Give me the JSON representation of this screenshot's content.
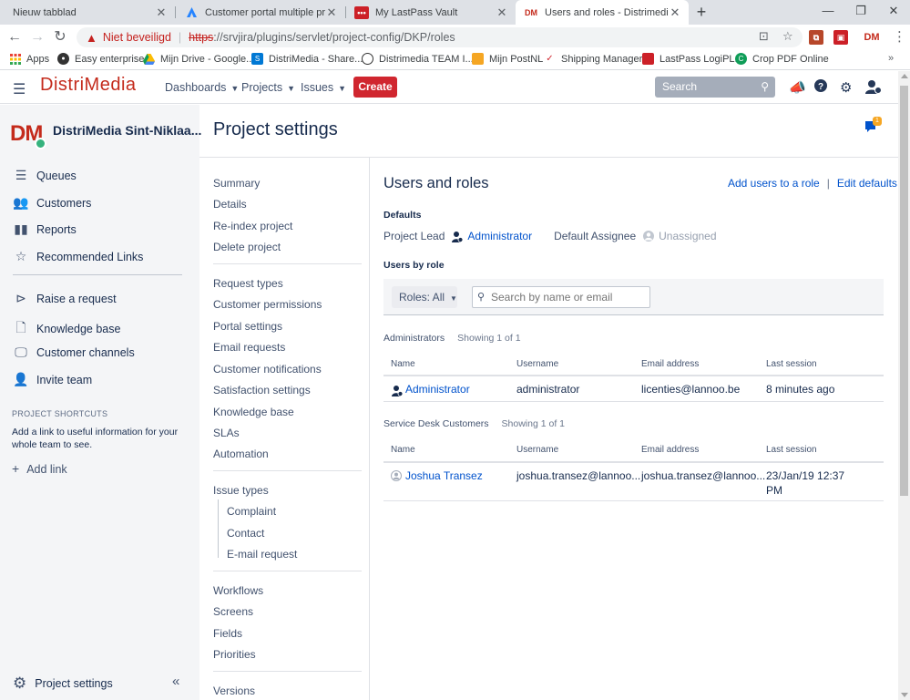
{
  "browser": {
    "tabs": [
      {
        "title": "Nieuw tabblad"
      },
      {
        "title": "Customer portal multiple project"
      },
      {
        "title": "My LastPass Vault"
      },
      {
        "title": "Users and roles - Distrimedia kla",
        "favicon_text": "DM"
      }
    ],
    "new_tab": "+",
    "close_glyph": "✕",
    "window_controls": [
      "—",
      "❐",
      "✕"
    ],
    "address": {
      "security_label": "Niet beveiligd",
      "protocol": "https",
      "url_rest": "://srvjira/plugins/servlet/project-config/DKP/roles"
    },
    "profile_text": "DM",
    "bookmarks": [
      {
        "label": "Apps"
      },
      {
        "label": "Easy enterprise"
      },
      {
        "label": "Mijn Drive - Google..."
      },
      {
        "label": "DistriMedia - Share..."
      },
      {
        "label": "Distrimedia TEAM I..."
      },
      {
        "label": "Mijn PostNL"
      },
      {
        "label": "Shipping Manager"
      },
      {
        "label": "LastPass LogiPL..."
      },
      {
        "label": "Crop PDF Online"
      }
    ]
  },
  "jira_nav": {
    "logo": "DistriMedia",
    "menus": [
      "Dashboards",
      "Projects",
      "Issues"
    ],
    "create_label": "Create",
    "search_placeholder": "Search"
  },
  "project": {
    "avatar_text": "DM",
    "name": "DistriMedia Sint-Niklaa...",
    "nav_primary": [
      "Queues",
      "Customers",
      "Reports",
      "Recommended Links"
    ],
    "nav_secondary": [
      "Raise a request",
      "Knowledge base",
      "Customer channels",
      "Invite team"
    ],
    "shortcuts_title": "PROJECT SHORTCUTS",
    "shortcuts_desc": "Add a link to useful information for your whole team to see.",
    "add_link": "Add link",
    "settings_label": "Project settings"
  },
  "page": {
    "title": "Project settings",
    "notification_count": "1"
  },
  "settings_nav": {
    "group1": [
      "Summary",
      "Details",
      "Re-index project",
      "Delete project"
    ],
    "group2": [
      "Request types",
      "Customer permissions",
      "Portal settings",
      "Email requests",
      "Customer notifications",
      "Satisfaction settings",
      "Knowledge base",
      "SLAs",
      "Automation"
    ],
    "issue_types": "Issue types",
    "issue_type_children": [
      "Complaint",
      "Contact",
      "E-mail request"
    ],
    "group4": [
      "Workflows",
      "Screens",
      "Fields",
      "Priorities"
    ],
    "group5": [
      "Versions"
    ]
  },
  "users_roles": {
    "title": "Users and roles",
    "add_users": "Add users to a role",
    "separator": "|",
    "edit_defaults": "Edit defaults",
    "defaults_heading": "Defaults",
    "project_lead_label": "Project Lead",
    "project_lead": "Administrator",
    "default_assignee_label": "Default Assignee",
    "default_assignee": "Unassigned",
    "by_role_heading": "Users by role",
    "roles_filter": "Roles: All",
    "search_placeholder": "Search by name or email",
    "columns": [
      "Name",
      "Username",
      "Email address",
      "Last session"
    ],
    "groups": [
      {
        "name": "Administrators",
        "showing": "Showing 1 of 1",
        "rows": [
          {
            "name": "Administrator",
            "username": "administrator",
            "email": "licenties@lannoo.be",
            "last_session": "8 minutes ago"
          }
        ]
      },
      {
        "name": "Service Desk Customers",
        "showing": "Showing 1 of 1",
        "rows": [
          {
            "name": "Joshua Transez",
            "username": "joshua.transez@lannoo...",
            "email": "joshua.transez@lannoo...",
            "last_session_line1": "23/Jan/19 12:37",
            "last_session_line2": "PM"
          }
        ]
      }
    ]
  },
  "colors": {
    "accent": "#0052cc",
    "create": "#d0262f",
    "brand": "#c42b1c"
  }
}
